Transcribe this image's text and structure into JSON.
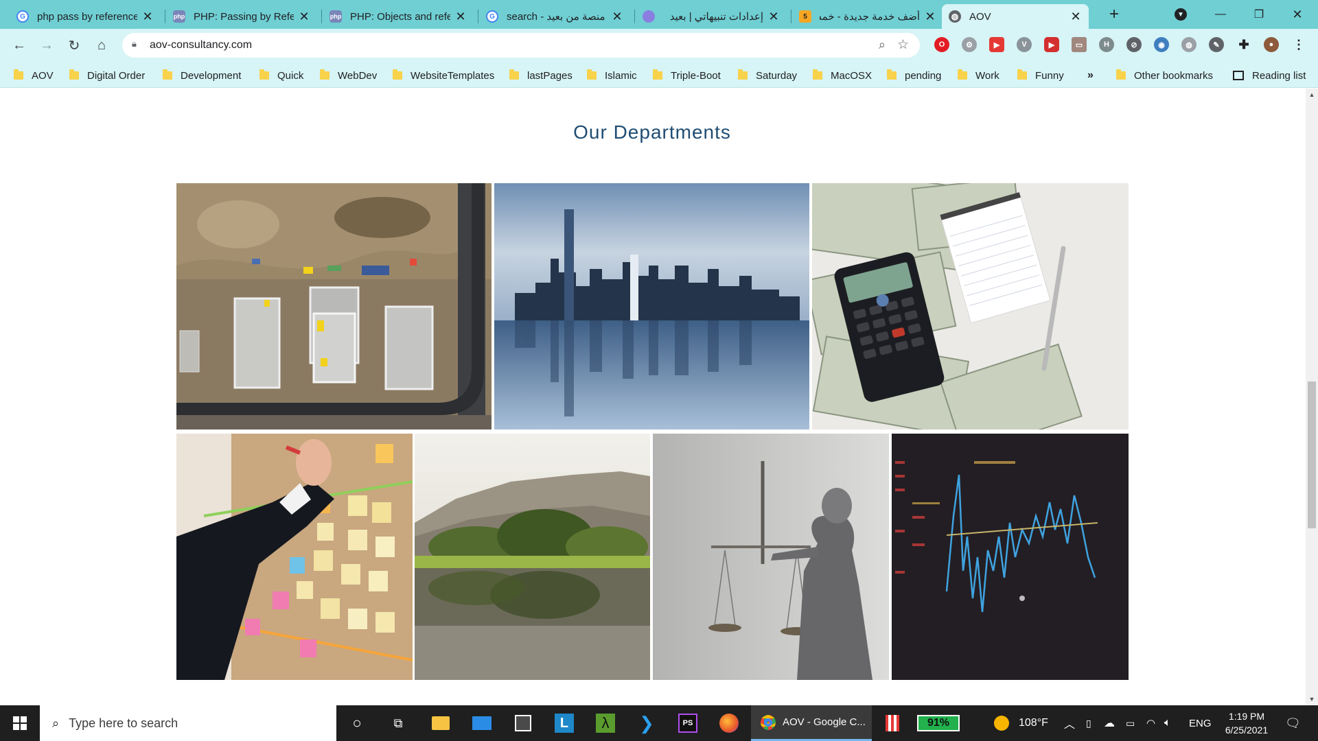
{
  "browser": {
    "tabs": [
      {
        "title": "php pass by reference",
        "favicon": "google-icon"
      },
      {
        "title": "PHP: Passing by Reference",
        "favicon": "php-icon"
      },
      {
        "title": "PHP: Objects and references",
        "favicon": "php-icon"
      },
      {
        "title": "search - منصة من بعيد",
        "favicon": "google-icon"
      },
      {
        "title": "إعدادات تنبيهاتي | بعيد",
        "favicon": "app-icon"
      },
      {
        "title": "أضف خدمة جديدة - خمسات",
        "favicon": "khamsat-icon"
      },
      {
        "title": "AOV",
        "favicon": "globe-icon",
        "active": true
      }
    ],
    "url": "aov-consultancy.com",
    "bookmarks": [
      "AOV",
      "Digital Order",
      "Development",
      "Quick",
      "WebDev",
      "WebsiteTemplates",
      "lastPages",
      "Islamic",
      "Triple-Boot",
      "Saturday",
      "MacOSX",
      "pending",
      "Work",
      "Funny"
    ],
    "overflow_label": "»",
    "other_bookmarks": "Other bookmarks",
    "reading_list": "Reading list",
    "accent": "#6fcfd3",
    "toolbar_color": "#d7f4f6"
  },
  "page": {
    "heading": "Our Departments",
    "heading_color": "#1f4d73",
    "departments": [
      {
        "image": "construction-site-aerial"
      },
      {
        "image": "city-skyline-reflection"
      },
      {
        "image": "money-calculator-notepad"
      },
      {
        "image": "sticky-notes-planning-board"
      },
      {
        "image": "lake-landscape-trees"
      },
      {
        "image": "lady-justice-scales"
      },
      {
        "image": "stock-market-chart-screen"
      }
    ]
  },
  "taskbar": {
    "search_placeholder": "Type here to search",
    "active_app_label": "AOV - Google C...",
    "battery": "91%",
    "weather": "108°F",
    "language": "ENG",
    "time": "1:19 PM",
    "date": "6/25/2021"
  }
}
